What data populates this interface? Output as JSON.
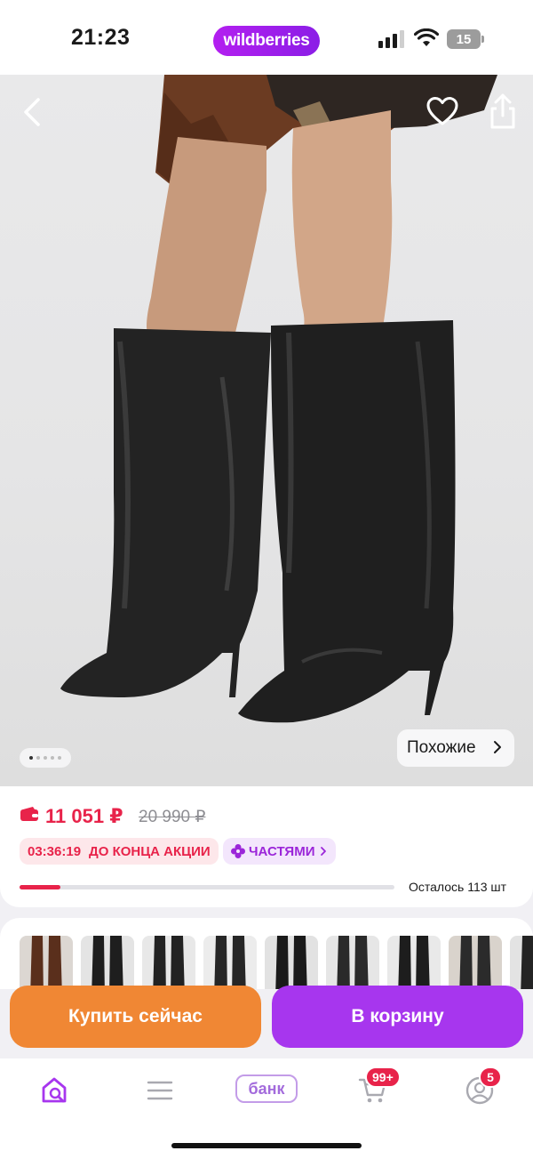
{
  "status_bar": {
    "time": "21:23",
    "app_logo": "wildberries",
    "battery": "15",
    "icons": [
      "signal-icon",
      "wifi-icon",
      "battery-icon"
    ]
  },
  "product": {
    "image_index": 0,
    "image_count": 5,
    "similar_label": "Похожие",
    "price_current": "11 051 ₽",
    "price_old": "20 990 ₽",
    "promo_timer": "03:36:19",
    "promo_text": "ДО КОНЦА АКЦИИ",
    "installments_label": "ЧАСТЯМИ",
    "stock_text": "Осталось 113 шт",
    "stock_level": 0.11,
    "variant_count": 9
  },
  "actions": {
    "buy_now": "Купить сейчас",
    "add_to_cart": "В корзину"
  },
  "nav": {
    "bank_label": "банк",
    "cart_badge": "99+",
    "profile_badge": "5"
  },
  "colors": {
    "accent_purple": "#a736ee",
    "buy_orange": "#f08734",
    "price_red": "#e8234a"
  }
}
